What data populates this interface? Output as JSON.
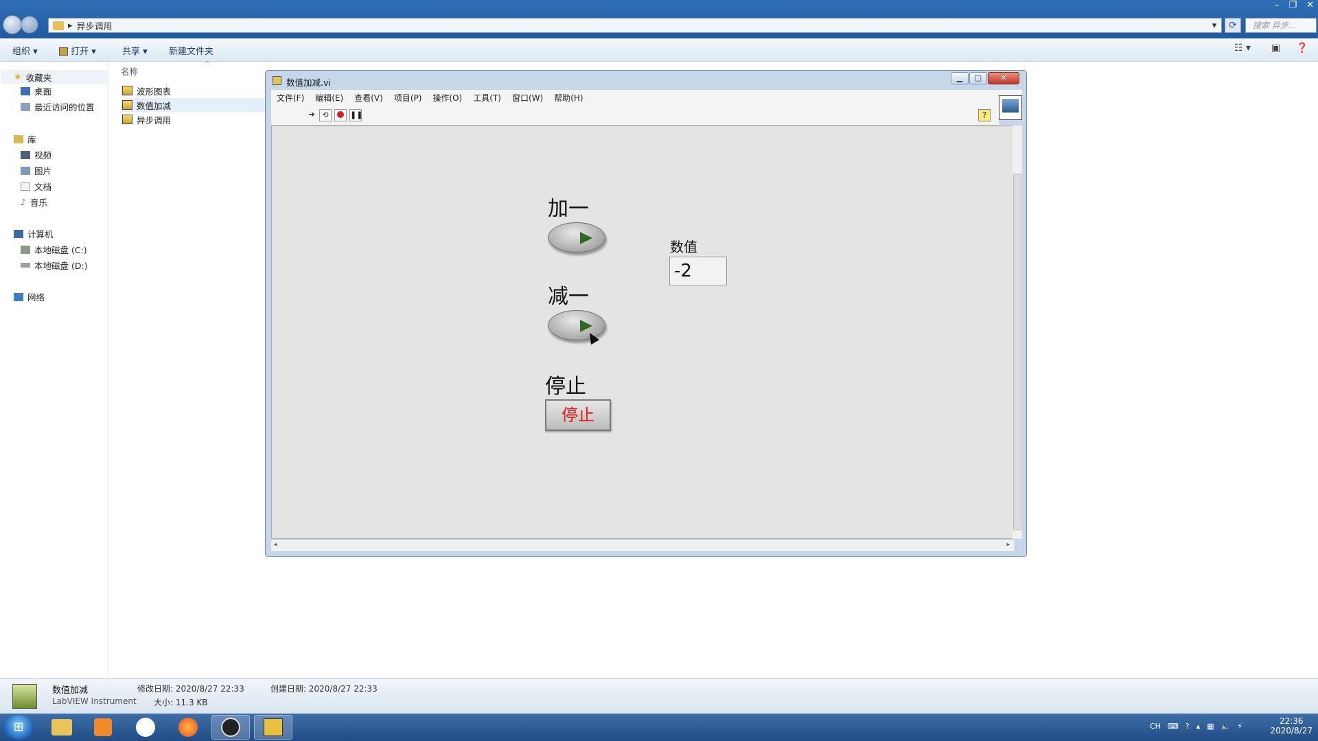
{
  "explorer": {
    "address": "异步调用",
    "search_placeholder": "搜索 异步...",
    "window_controls": [
      "–",
      "❐",
      "✕"
    ],
    "toolbar": {
      "organize": "组织 ▾",
      "open": "打开 ▾",
      "share": "共享 ▾",
      "new_folder": "新建文件夹"
    },
    "nav": {
      "favorites": "收藏夹",
      "desktop": "桌面",
      "recent": "最近访问的位置",
      "libraries": "库",
      "videos": "视频",
      "pictures": "图片",
      "documents": "文档",
      "music": "音乐",
      "computer": "计算机",
      "drive_c": "本地磁盘 (C:)",
      "drive_d": "本地磁盘 (D:)",
      "network": "网络"
    },
    "columns": {
      "name": "名称"
    },
    "files": [
      {
        "name": "波形图表"
      },
      {
        "name": "数值加减"
      },
      {
        "name": "异步调用"
      }
    ],
    "details": {
      "name": "数值加减",
      "type": "LabVIEW Instrument",
      "modified": "修改日期: 2020/8/27 22:33",
      "size": "大小: 11.3 KB",
      "created": "创建日期: 2020/8/27 22:33"
    }
  },
  "vi_window": {
    "title": "数值加减.vi",
    "menus": [
      "文件(F)",
      "编辑(E)",
      "查看(V)",
      "项目(P)",
      "操作(O)",
      "工具(T)",
      "窗口(W)",
      "帮助(H)"
    ],
    "help_symbol": "?",
    "controls": {
      "inc_label": "加一",
      "dec_label": "减一",
      "stop_label": "停止",
      "stop_button_text": "停止",
      "numeric_label": "数值",
      "numeric_value": "-2"
    }
  },
  "taskbar": {
    "tray_lang": "CH",
    "time": "22:36",
    "date": "2020/8/27"
  },
  "colors": {
    "explorer_titlebar": "#2f6fb7",
    "panel_bg": "#e4e4e4",
    "stop_text": "#e21b1b",
    "taskbar": "#214c85"
  }
}
